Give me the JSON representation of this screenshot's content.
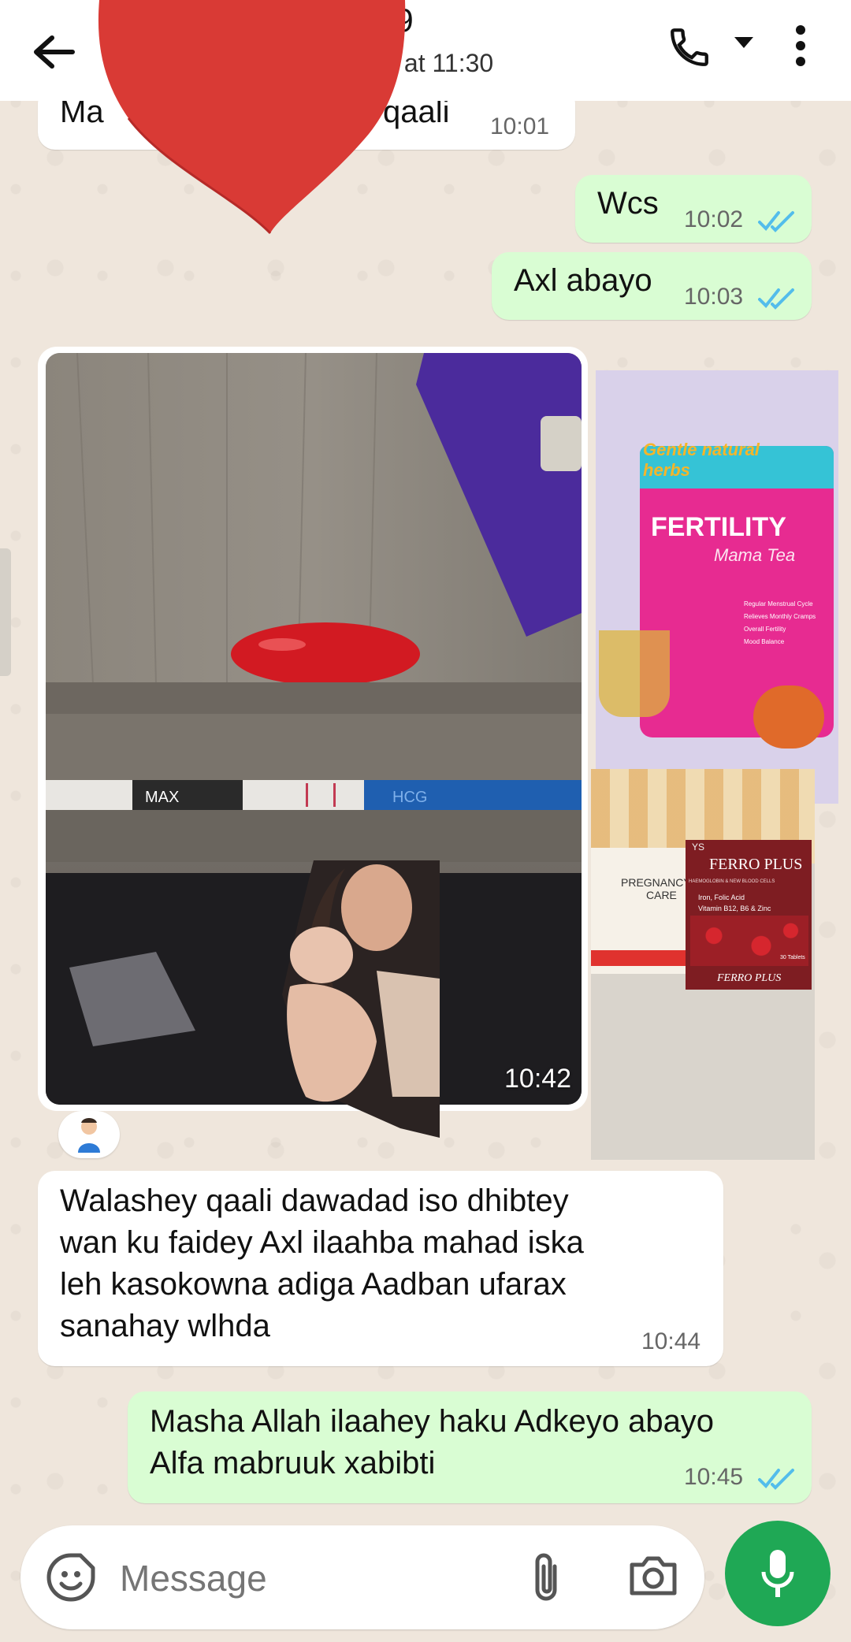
{
  "header": {
    "title_fragment": "79",
    "subtitle_fragment": "y at 11:30",
    "back_icon": "arrow-left-icon",
    "call_icon": "phone-icon",
    "menu_icon": "more-vert-icon"
  },
  "messages": [
    {
      "id": "m1",
      "direction": "in",
      "text": "Ma",
      "text2": "qaali",
      "time": "10:01"
    },
    {
      "id": "m2",
      "direction": "out",
      "text": "Wcs",
      "time": "10:02"
    },
    {
      "id": "m3",
      "direction": "out",
      "text": "Axl abayo",
      "time": "10:03"
    },
    {
      "id": "m4",
      "direction": "in",
      "media": "photo",
      "time": "10:42",
      "test_label": "MAX",
      "test_brand": "HCG"
    },
    {
      "id": "m5",
      "direction": "in",
      "text_lines": [
        "Walashey qaali dawadad iso dhibtey",
        "wan ku faidey Axl ilaahba mahad iska",
        "leh kasokowna adiga Aadban ufarax",
        "sanahay wlhda"
      ],
      "time": "10:44"
    },
    {
      "id": "m6",
      "direction": "out",
      "text_lines": [
        "Masha Allah ilaahey haku Adkeyo abayo",
        "Alfa mabruuk xabibti"
      ],
      "time": "10:45"
    }
  ],
  "products": {
    "fertility": {
      "tag": "Gentle natural herbs",
      "name": "FERTILITY",
      "sub": "Mama Tea",
      "bullets": [
        "Regular Menstrual Cycle",
        "Relieves Monthly Cramps",
        "Overall Fertility",
        "Mood Balance"
      ],
      "bg": "#e72b91"
    },
    "pregnancy": {
      "line1": "PREGNANCY",
      "line2": "CARE"
    },
    "ferro": {
      "brand": "YS",
      "name": "FERRO PLUS",
      "line": "HAEMOGLOBIN & NEW BLOOD CELLS",
      "detail1": "Iron, Folic Acid",
      "detail2": "Vitamin B12, B6 & Zinc",
      "bottom": "FERRO PLUS",
      "count": "30 Tablets"
    }
  },
  "composer": {
    "placeholder": "Message",
    "emoji_icon": "sticker-smile-icon",
    "attach_icon": "paperclip-icon",
    "camera_icon": "camera-icon",
    "mic_icon": "mic-icon"
  },
  "colors": {
    "header_bg": "#ffffff",
    "wall": "#efe6dc",
    "out_bubble": "#d9fdd3",
    "in_bubble": "#ffffff",
    "accent": "#1fa855",
    "tick": "#53bdeb",
    "heart": "#d93a35"
  }
}
